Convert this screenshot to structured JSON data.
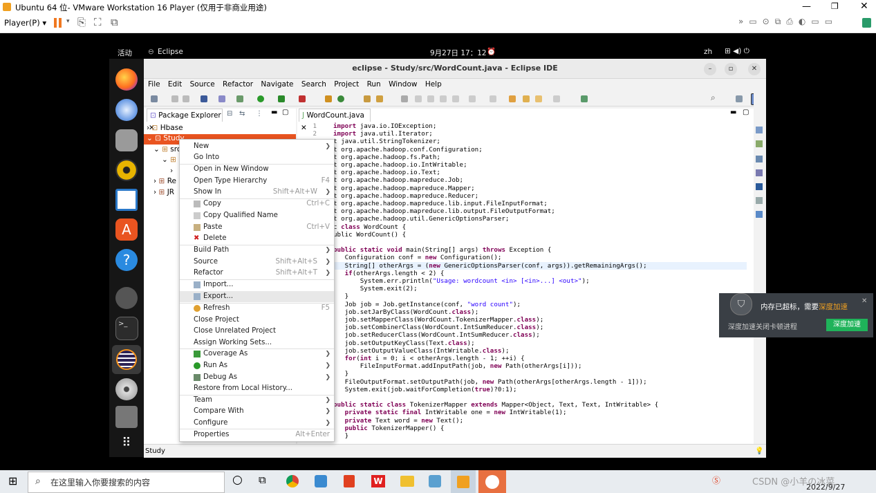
{
  "vmware": {
    "title": "Ubuntu 64 位- VMware Workstation 16 Player (仅用于非商业用途)",
    "player_menu": "Player(P)"
  },
  "ubuntu": {
    "activities": "活动",
    "app_name": "Eclipse",
    "clock": "9月27日  17：12",
    "lang": "zh"
  },
  "eclipse": {
    "title": "eclipse - Study/src/WordCount.java - Eclipse IDE",
    "menu": [
      "File",
      "Edit",
      "Source",
      "Refactor",
      "Navigate",
      "Search",
      "Project",
      "Run",
      "Window",
      "Help"
    ],
    "package_explorer_tab": "Package Explorer",
    "editor_tab": "WordCount.java",
    "tree": {
      "hbase": "Hbase",
      "study": "Study",
      "src": "src",
      "re": "Re",
      "jr": "JR"
    },
    "status": "Study"
  },
  "code": [
    "import java.io.IOException;",
    "import java.util.Iterator;",
    "t java.util.StringTokenizer;",
    "t org.apache.hadoop.conf.Configuration;",
    "t org.apache.hadoop.fs.Path;",
    "t org.apache.hadoop.io.IntWritable;",
    "t org.apache.hadoop.io.Text;",
    "t org.apache.hadoop.mapreduce.Job;",
    "t org.apache.hadoop.mapreduce.Mapper;",
    "t org.apache.hadoop.mapreduce.Reducer;",
    "t org.apache.hadoop.mapreduce.lib.input.FileInputFormat;",
    "t org.apache.hadoop.mapreduce.lib.output.FileOutputFormat;",
    "t org.apache.hadoop.util.GenericOptionsParser;",
    "c class WordCount {",
    "ublic WordCount() {",
    "",
    "public static void main(String[] args) throws Exception {",
    "   Configuration conf = new Configuration();",
    "   String[] otherArgs = (new GenericOptionsParser(conf, args)).getRemainingArgs();",
    "   if(otherArgs.length < 2) {",
    "       System.err.println(\"Usage: wordcount <in> [<in>...] <out>\");",
    "       System.exit(2);",
    "   }",
    "   Job job = Job.getInstance(conf, \"word count\");",
    "   job.setJarByClass(WordCount.class);",
    "   job.setMapperClass(WordCount.TokenizerMapper.class);",
    "   job.setCombinerClass(WordCount.IntSumReducer.class);",
    "   job.setReducerClass(WordCount.IntSumReducer.class);",
    "   job.setOutputKeyClass(Text.class);",
    "   job.setOutputValueClass(IntWritable.class);",
    "   for(int i = 0; i < otherArgs.length - 1; ++i) {",
    "       FileInputFormat.addInputPath(job, new Path(otherArgs[i]));",
    "   }",
    "   FileOutputFormat.setOutputPath(job, new Path(otherArgs[otherArgs.length - 1]));",
    "   System.exit(job.waitForCompletion(true)?0:1);",
    "",
    "public static class TokenizerMapper extends Mapper<Object, Text, Text, IntWritable> {",
    "   private static final IntWritable one = new IntWritable(1);",
    "   private Text word = new Text();",
    "   public TokenizerMapper() {",
    "   }"
  ],
  "line_numbers": [
    "1",
    "2"
  ],
  "context_menu": {
    "new": "New",
    "go_into": "Go Into",
    "open_new_window": "Open in New Window",
    "open_type_hierarchy": "Open Type Hierarchy",
    "open_type_hierarchy_sc": "F4",
    "show_in": "Show In",
    "show_in_sc": "Shift+Alt+W",
    "copy": "Copy",
    "copy_sc": "Ctrl+C",
    "copy_qualified": "Copy Qualified Name",
    "paste": "Paste",
    "paste_sc": "Ctrl+V",
    "delete": "Delete",
    "build_path": "Build Path",
    "source": "Source",
    "source_sc": "Shift+Alt+S",
    "refactor": "Refactor",
    "refactor_sc": "Shift+Alt+T",
    "import": "Import...",
    "export": "Export...",
    "refresh": "Refresh",
    "refresh_sc": "F5",
    "close_project": "Close Project",
    "close_unrelated": "Close Unrelated Project",
    "assign_working_sets": "Assign Working Sets...",
    "coverage_as": "Coverage As",
    "run_as": "Run As",
    "debug_as": "Debug As",
    "restore_history": "Restore from Local History...",
    "team": "Team",
    "compare_with": "Compare With",
    "configure": "Configure",
    "properties": "Properties",
    "properties_sc": "Alt+Enter"
  },
  "notification": {
    "title_prefix": "内存已超标，需要",
    "title_link": "深度加速",
    "message": "深度加速关闭卡顿进程",
    "button": "深度加速"
  },
  "taskbar": {
    "search_placeholder": "在这里输入你要搜索的内容",
    "date": "2022/9/27",
    "watermark": "CSDN @小羊の冰菜"
  }
}
